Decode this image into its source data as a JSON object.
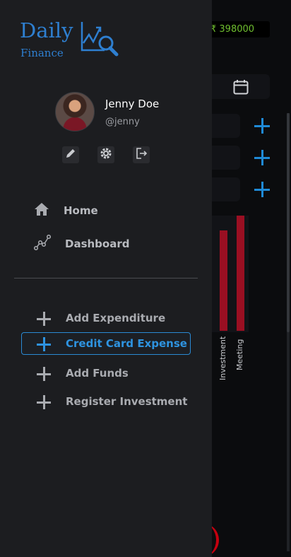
{
  "background": {
    "balance": "₹ 398000",
    "chart_labels": [
      "Investment",
      "Meeting"
    ]
  },
  "logo": {
    "line1": "Daily",
    "line2": "Finance"
  },
  "user": {
    "name": "Jenny Doe",
    "handle": "@jenny"
  },
  "profile_actions": [
    "edit-icon",
    "settings-icon",
    "logout-icon"
  ],
  "nav": [
    {
      "label": "Home",
      "icon": "home-icon"
    },
    {
      "label": "Dashboard",
      "icon": "chart-line-icon"
    }
  ],
  "actions": [
    {
      "label": "Add Expenditure",
      "active": false
    },
    {
      "label": "Credit Card Expense",
      "active": true
    },
    {
      "label": "Add Funds",
      "active": false
    },
    {
      "label": "Register Investment",
      "active": false
    }
  ],
  "colors": {
    "accent": "#2e93e0",
    "drawer_bg": "#1c1d20",
    "balance_text": "#6fbf2f",
    "bar": "#9a0f22"
  }
}
